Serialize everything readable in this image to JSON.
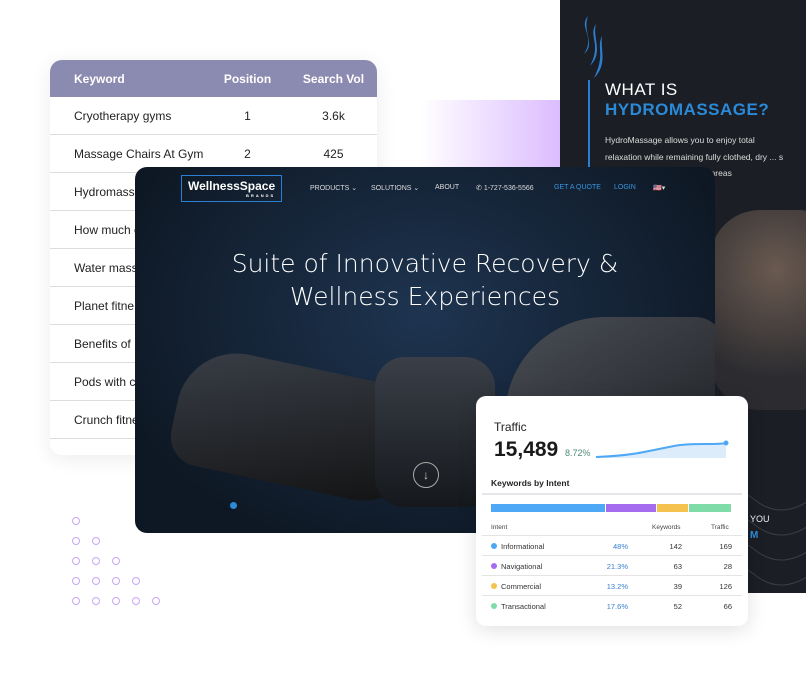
{
  "keyword_table": {
    "headers": [
      "Keyword",
      "Position",
      "Search Vol"
    ],
    "rows": [
      [
        "Cryotherapy gyms",
        "1",
        "3.6k"
      ],
      [
        "Massage Chairs At Gym",
        "2",
        "425"
      ],
      [
        "Hydromassa",
        "",
        ""
      ],
      [
        "How much c",
        "",
        ""
      ],
      [
        "Water mass",
        "",
        ""
      ],
      [
        "Planet fitne",
        "",
        ""
      ],
      [
        "Benefits of",
        "",
        ""
      ],
      [
        "Pods with c",
        "",
        ""
      ],
      [
        "Crunch fitne",
        "",
        ""
      ]
    ],
    "header_color": "#8b8ab0"
  },
  "promo": {
    "title_line1": "WHAT IS",
    "title_line2": "HYDROMASSAGE?",
    "body": "HydroMassage allows you to enjoy total relaxation while remaining fully clothed, dry ... s you're ... of heated ... et the areas",
    "footer_line1": "YOU",
    "footer_line2": "M",
    "accent": "#2a8ad8"
  },
  "hero": {
    "logo": "WellnessSpace",
    "logo_sub": "BRANDS",
    "nav": [
      "PRODUCTS",
      "SOLUTIONS",
      "ABOUT"
    ],
    "phone": "1-727-536-5566",
    "quote": "GET A QUOTE",
    "login": "LOGIN",
    "title_line1": "Suite of Innovative Recovery &",
    "title_line2": "Wellness Experiences",
    "scroll_icon": "arrow-down-circle-icon"
  },
  "traffic": {
    "label": "Traffic",
    "value": "15,489",
    "change": "8.72%",
    "section": "Keywords by Intent",
    "headers": {
      "intent": "Intent",
      "keywords": "Keywords",
      "traffic": "Traffic"
    },
    "rows": [
      {
        "intent": "Informational",
        "share": "48%",
        "keywords": "142",
        "traffic": "169",
        "color": "#4fa8f5"
      },
      {
        "intent": "Navigational",
        "share": "21.3%",
        "keywords": "63",
        "traffic": "28",
        "color": "#a66cf0"
      },
      {
        "intent": "Commercial",
        "share": "13.2%",
        "keywords": "39",
        "traffic": "126",
        "color": "#f5c14f"
      },
      {
        "intent": "Transactional",
        "share": "17.6%",
        "keywords": "52",
        "traffic": "66",
        "color": "#7fdca8"
      }
    ]
  }
}
